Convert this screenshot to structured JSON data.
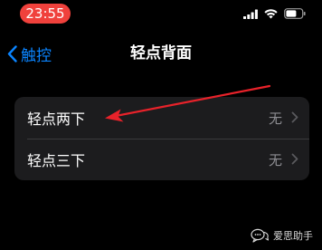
{
  "status_bar": {
    "time": "23:55",
    "time_pill_color": "#f0413c",
    "icons": [
      "signal-icon",
      "wifi-icon",
      "battery-icon"
    ]
  },
  "nav": {
    "back_label": "触控",
    "title": "轻点背面",
    "accent_color": "#0a84ff"
  },
  "settings": {
    "rows": [
      {
        "label": "轻点两下",
        "value": "无"
      },
      {
        "label": "轻点三下",
        "value": "无"
      }
    ]
  },
  "annotation": {
    "color": "#e8222a",
    "target": "double-tap-row"
  },
  "watermark": {
    "text": "爱思助手"
  }
}
